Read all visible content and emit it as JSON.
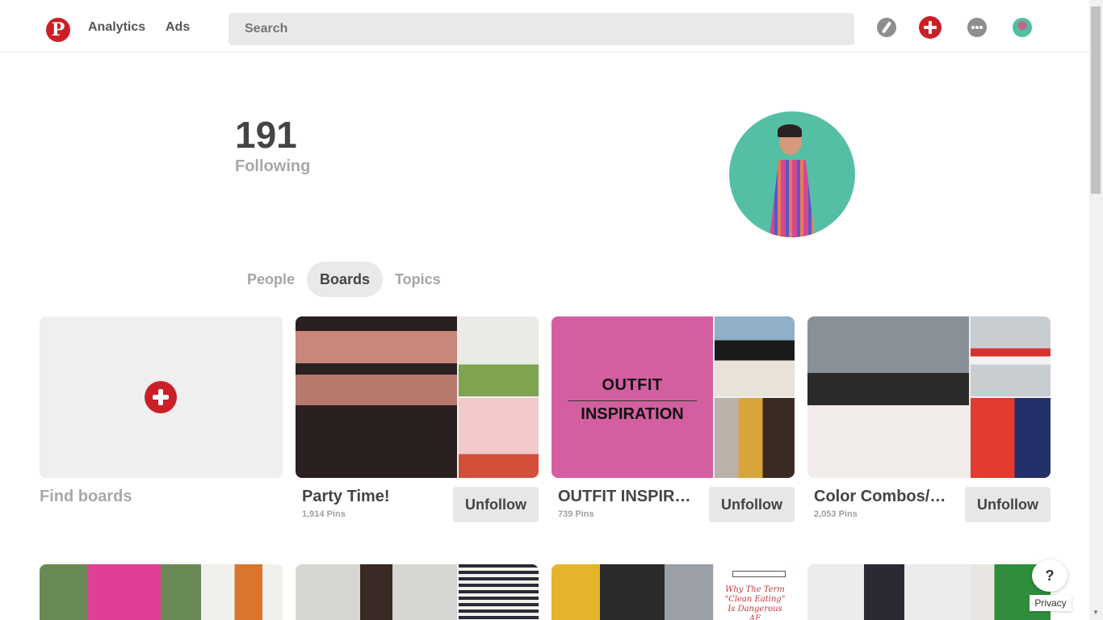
{
  "header": {
    "logo_glyph": "P",
    "nav": [
      "Analytics",
      "Ads"
    ],
    "search_placeholder": "Search",
    "icons": [
      "compass-icon",
      "add-icon",
      "messages-icon",
      "profile-avatar"
    ]
  },
  "profile": {
    "count": "191",
    "count_label": "Following"
  },
  "tabs": [
    {
      "label": "People",
      "active": false
    },
    {
      "label": "Boards",
      "active": true
    },
    {
      "label": "Topics",
      "active": false
    }
  ],
  "find_boards": {
    "label": "Find boards"
  },
  "boards": [
    {
      "title": "Party Time!",
      "pins": "1,914 Pins",
      "button": "Unfollow"
    },
    {
      "title": "OUTFIT INSPIR…",
      "pins": "739 Pins",
      "button": "Unfollow",
      "cover_text_1": "OUTFIT",
      "cover_text_2": "INSPIRATION"
    },
    {
      "title": "Color Combos/…",
      "pins": "2,053 Pins",
      "button": "Unfollow"
    }
  ],
  "row2_cover_texts": {
    "caption": "Why The Term \"Clean Eating\" Is Dangerous AF"
  },
  "help": {
    "label": "?",
    "privacy": "Privacy"
  },
  "colors": {
    "brand_red": "#cb1f27",
    "outfit_pink": "#d45fa0",
    "tab_bg": "#e9e9e9"
  }
}
